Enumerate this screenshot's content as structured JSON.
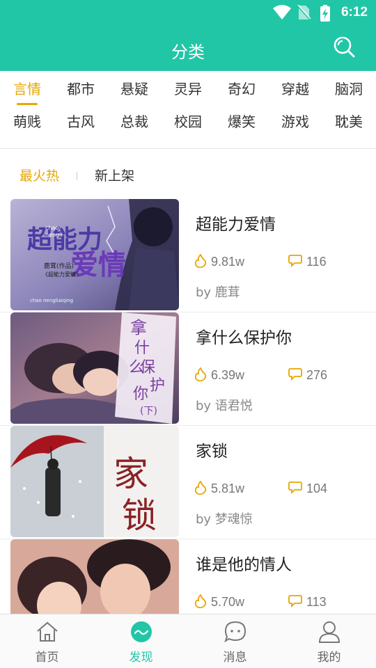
{
  "status_bar": {
    "time": "6:12"
  },
  "header": {
    "title": "分类"
  },
  "categories": [
    [
      "言情",
      "都市",
      "悬疑",
      "灵异",
      "奇幻",
      "穿越",
      "脑洞"
    ],
    [
      "萌贱",
      "古风",
      "总裁",
      "校园",
      "爆笑",
      "游戏",
      "耽美"
    ]
  ],
  "active_category": "言情",
  "sort_tabs": {
    "hot": "最火热",
    "new": "新上架",
    "active": "最火热"
  },
  "books": [
    {
      "title": "超能力爱情",
      "hot": "9.81w",
      "comments": "116",
      "author": "by 鹿茸",
      "cover_text": {
        "main": "超能力",
        "sub": "爱情",
        "small1": "chao",
        "small2": "nengli",
        "credit1": "鹿茸(作品)",
        "credit2": "《超能力爱情》",
        "bottom": "chao nengliaiqing"
      }
    },
    {
      "title": "拿什么保护你",
      "hot": "6.39w",
      "comments": "276",
      "author": "by 语君悦",
      "cover_text": {
        "c1": "拿",
        "c2": "什",
        "c3": "么",
        "c4": "保",
        "c5": "护",
        "c6": "你",
        "c7": "(下)"
      }
    },
    {
      "title": "家锁",
      "hot": "5.81w",
      "comments": "104",
      "author": "by 梦魂惊",
      "cover_text": {
        "c1": "家",
        "c2": "锁"
      }
    },
    {
      "title": "谁是他的情人",
      "hot": "5.70w",
      "comments": "113",
      "author": ""
    }
  ],
  "bottom_nav": [
    {
      "label": "首页",
      "icon": "home-icon"
    },
    {
      "label": "发现",
      "icon": "discover-icon"
    },
    {
      "label": "消息",
      "icon": "message-icon"
    },
    {
      "label": "我的",
      "icon": "profile-icon"
    }
  ],
  "active_nav": "发现",
  "colors": {
    "brand": "#21c6a7",
    "accent": "#e8a600"
  }
}
